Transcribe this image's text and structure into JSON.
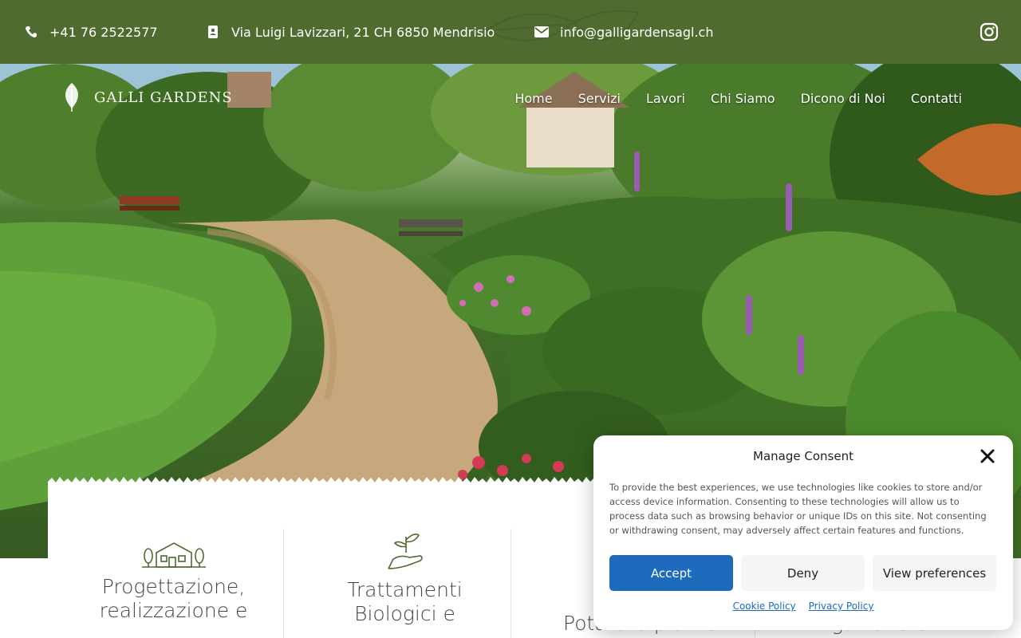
{
  "topbar": {
    "phone": "+41 76 2522577",
    "address": "Via Luigi Lavizzari, 21 CH 6850 Mendrisio",
    "email": "info@galligardensagl.ch",
    "bg_color": "#4f6b30"
  },
  "brand": {
    "name": "GALLI GARDENS"
  },
  "nav": [
    "Home",
    "Servizi",
    "Lavori",
    "Chi Siamo",
    "Dicono di Noi",
    "Contatti"
  ],
  "services": [
    {
      "title_line1": "Progettazione,",
      "title_line2": "realizzazione e",
      "icon": "house-garden-icon"
    },
    {
      "title_line1": "Trattamenti",
      "title_line2": "Biologici e",
      "icon": "plant-hand-icon"
    },
    {
      "title_line1": "Potatura piante",
      "title_line2": "",
      "icon": ""
    },
    {
      "title_line1": "Irrigazione e",
      "title_line2": "",
      "icon": ""
    }
  ],
  "consent": {
    "title": "Manage Consent",
    "text": "To provide the best experiences, we use technologies like cookies to store and/or access device information. Consenting to these technologies will allow us to process data such as browsing behavior or unique IDs on this site. Not consenting or withdrawing consent, may adversely affect certain features and functions.",
    "accept": "Accept",
    "deny": "Deny",
    "preferences": "View preferences",
    "cookie_policy": "Cookie Policy",
    "privacy_policy": "Privacy Policy",
    "accent_color": "#1e6bbd"
  }
}
